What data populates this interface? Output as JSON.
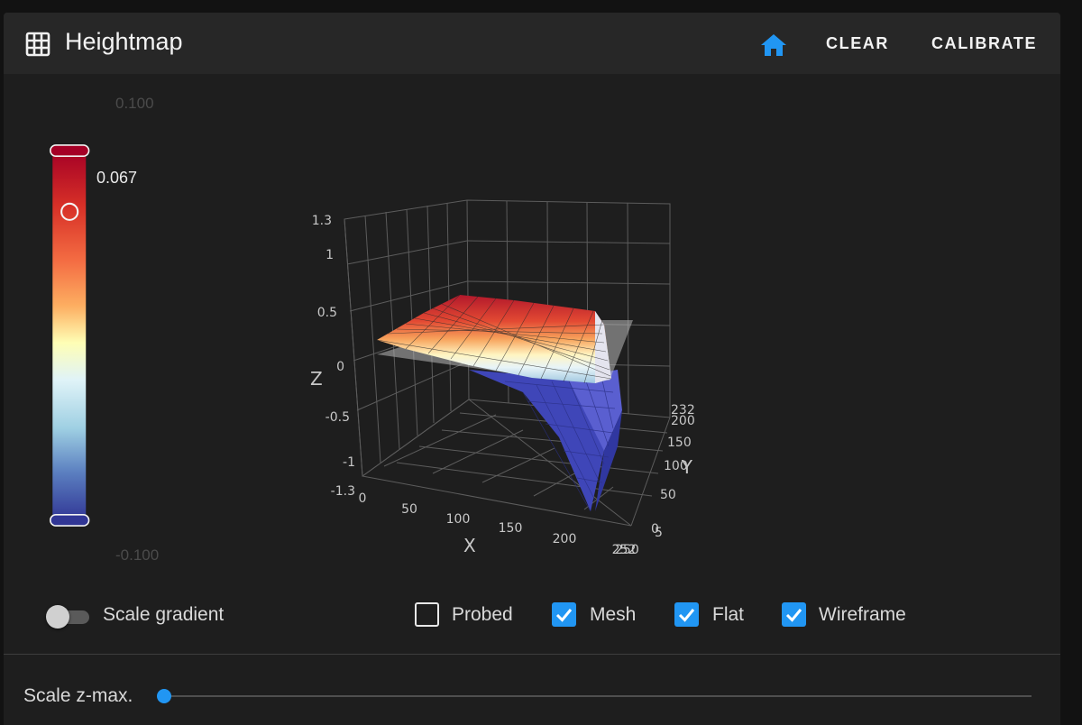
{
  "header": {
    "title": "Heightmap",
    "clear_label": "CLEAR",
    "calibrate_label": "CALIBRATE",
    "title_icon": "grid-icon",
    "home_icon": "home-icon"
  },
  "color_scale": {
    "max": "0.100",
    "min": "-0.100",
    "current": "0.067",
    "colors": [
      "#a50026",
      "#f46d43",
      "#fee090",
      "#e0f3f8",
      "#74add1",
      "#313695"
    ]
  },
  "plot": {
    "z_axis_title": "Z",
    "x_axis_title": "X",
    "y_axis_title": "Y",
    "z_ticks": [
      "1.3",
      "1",
      "0.5",
      "0",
      "-0.5",
      "-1",
      "-1.3"
    ],
    "x_ticks": [
      "0",
      "50",
      "100",
      "150",
      "200",
      "252"
    ],
    "y_ticks": [
      "232",
      "200",
      "150",
      "100",
      "50",
      "0",
      "5",
      "250"
    ]
  },
  "controls": {
    "scale_gradient_label": "Scale gradient",
    "scale_gradient_on": false,
    "probed_label": "Probed",
    "probed_checked": false,
    "mesh_label": "Mesh",
    "mesh_checked": true,
    "flat_label": "Flat",
    "flat_checked": true,
    "wireframe_label": "Wireframe",
    "wireframe_checked": true
  },
  "zmax": {
    "label": "Scale z-max.",
    "value": 0
  },
  "accent_color": "#2196f3"
}
